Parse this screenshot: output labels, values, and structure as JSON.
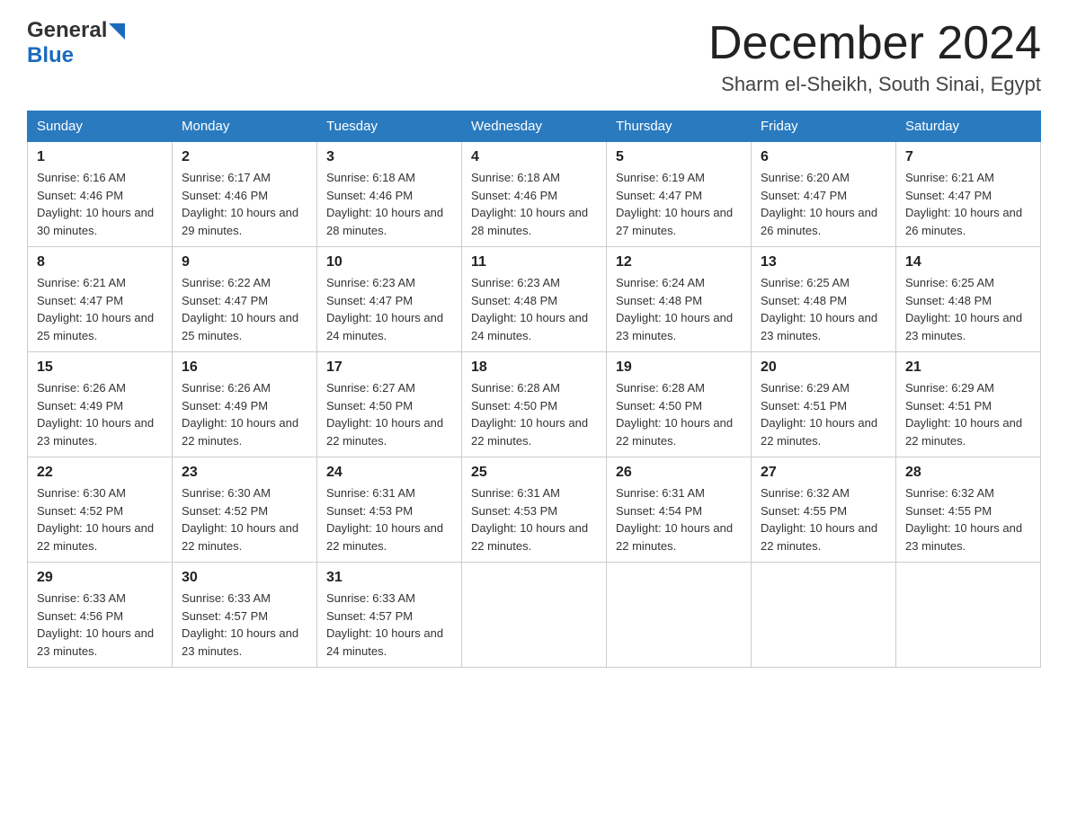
{
  "header": {
    "logo_general": "General",
    "logo_blue": "Blue",
    "month_title": "December 2024",
    "location": "Sharm el-Sheikh, South Sinai, Egypt"
  },
  "weekdays": [
    "Sunday",
    "Monday",
    "Tuesday",
    "Wednesday",
    "Thursday",
    "Friday",
    "Saturday"
  ],
  "weeks": [
    [
      {
        "day": "1",
        "sunrise": "6:16 AM",
        "sunset": "4:46 PM",
        "daylight": "10 hours and 30 minutes."
      },
      {
        "day": "2",
        "sunrise": "6:17 AM",
        "sunset": "4:46 PM",
        "daylight": "10 hours and 29 minutes."
      },
      {
        "day": "3",
        "sunrise": "6:18 AM",
        "sunset": "4:46 PM",
        "daylight": "10 hours and 28 minutes."
      },
      {
        "day": "4",
        "sunrise": "6:18 AM",
        "sunset": "4:46 PM",
        "daylight": "10 hours and 28 minutes."
      },
      {
        "day": "5",
        "sunrise": "6:19 AM",
        "sunset": "4:47 PM",
        "daylight": "10 hours and 27 minutes."
      },
      {
        "day": "6",
        "sunrise": "6:20 AM",
        "sunset": "4:47 PM",
        "daylight": "10 hours and 26 minutes."
      },
      {
        "day": "7",
        "sunrise": "6:21 AM",
        "sunset": "4:47 PM",
        "daylight": "10 hours and 26 minutes."
      }
    ],
    [
      {
        "day": "8",
        "sunrise": "6:21 AM",
        "sunset": "4:47 PM",
        "daylight": "10 hours and 25 minutes."
      },
      {
        "day": "9",
        "sunrise": "6:22 AM",
        "sunset": "4:47 PM",
        "daylight": "10 hours and 25 minutes."
      },
      {
        "day": "10",
        "sunrise": "6:23 AM",
        "sunset": "4:47 PM",
        "daylight": "10 hours and 24 minutes."
      },
      {
        "day": "11",
        "sunrise": "6:23 AM",
        "sunset": "4:48 PM",
        "daylight": "10 hours and 24 minutes."
      },
      {
        "day": "12",
        "sunrise": "6:24 AM",
        "sunset": "4:48 PM",
        "daylight": "10 hours and 23 minutes."
      },
      {
        "day": "13",
        "sunrise": "6:25 AM",
        "sunset": "4:48 PM",
        "daylight": "10 hours and 23 minutes."
      },
      {
        "day": "14",
        "sunrise": "6:25 AM",
        "sunset": "4:48 PM",
        "daylight": "10 hours and 23 minutes."
      }
    ],
    [
      {
        "day": "15",
        "sunrise": "6:26 AM",
        "sunset": "4:49 PM",
        "daylight": "10 hours and 23 minutes."
      },
      {
        "day": "16",
        "sunrise": "6:26 AM",
        "sunset": "4:49 PM",
        "daylight": "10 hours and 22 minutes."
      },
      {
        "day": "17",
        "sunrise": "6:27 AM",
        "sunset": "4:50 PM",
        "daylight": "10 hours and 22 minutes."
      },
      {
        "day": "18",
        "sunrise": "6:28 AM",
        "sunset": "4:50 PM",
        "daylight": "10 hours and 22 minutes."
      },
      {
        "day": "19",
        "sunrise": "6:28 AM",
        "sunset": "4:50 PM",
        "daylight": "10 hours and 22 minutes."
      },
      {
        "day": "20",
        "sunrise": "6:29 AM",
        "sunset": "4:51 PM",
        "daylight": "10 hours and 22 minutes."
      },
      {
        "day": "21",
        "sunrise": "6:29 AM",
        "sunset": "4:51 PM",
        "daylight": "10 hours and 22 minutes."
      }
    ],
    [
      {
        "day": "22",
        "sunrise": "6:30 AM",
        "sunset": "4:52 PM",
        "daylight": "10 hours and 22 minutes."
      },
      {
        "day": "23",
        "sunrise": "6:30 AM",
        "sunset": "4:52 PM",
        "daylight": "10 hours and 22 minutes."
      },
      {
        "day": "24",
        "sunrise": "6:31 AM",
        "sunset": "4:53 PM",
        "daylight": "10 hours and 22 minutes."
      },
      {
        "day": "25",
        "sunrise": "6:31 AM",
        "sunset": "4:53 PM",
        "daylight": "10 hours and 22 minutes."
      },
      {
        "day": "26",
        "sunrise": "6:31 AM",
        "sunset": "4:54 PM",
        "daylight": "10 hours and 22 minutes."
      },
      {
        "day": "27",
        "sunrise": "6:32 AM",
        "sunset": "4:55 PM",
        "daylight": "10 hours and 22 minutes."
      },
      {
        "day": "28",
        "sunrise": "6:32 AM",
        "sunset": "4:55 PM",
        "daylight": "10 hours and 23 minutes."
      }
    ],
    [
      {
        "day": "29",
        "sunrise": "6:33 AM",
        "sunset": "4:56 PM",
        "daylight": "10 hours and 23 minutes."
      },
      {
        "day": "30",
        "sunrise": "6:33 AM",
        "sunset": "4:57 PM",
        "daylight": "10 hours and 23 minutes."
      },
      {
        "day": "31",
        "sunrise": "6:33 AM",
        "sunset": "4:57 PM",
        "daylight": "10 hours and 24 minutes."
      },
      null,
      null,
      null,
      null
    ]
  ],
  "labels": {
    "sunrise": "Sunrise:",
    "sunset": "Sunset:",
    "daylight": "Daylight:"
  }
}
